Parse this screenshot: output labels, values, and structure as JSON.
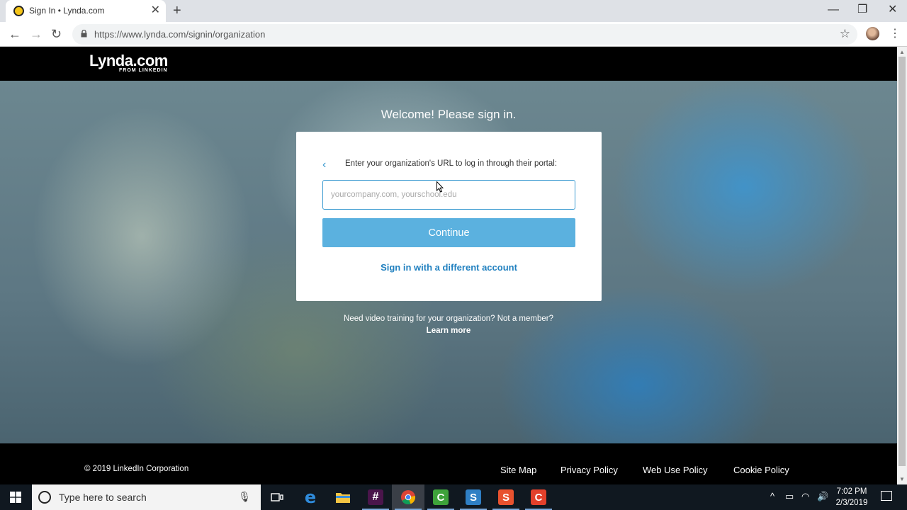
{
  "browser": {
    "tab_title": "Sign In • Lynda.com",
    "url": "https://www.lynda.com/signin/organization"
  },
  "site": {
    "logo_main": "Lynda.com",
    "logo_sub": "FROM LINKEDIN"
  },
  "signin": {
    "welcome": "Welcome! Please sign in.",
    "instruction": "Enter your organization's URL to log in through their portal:",
    "input_placeholder": "yourcompany.com, yourschool.edu",
    "continue_label": "Continue",
    "alt_link": "Sign in with a different account",
    "below_text": "Need video training for your organization? Not a member?",
    "learn_more": "Learn more"
  },
  "footer": {
    "copyright": "© 2019 LinkedIn Corporation",
    "links": [
      "Site Map",
      "Privacy Policy",
      "Web Use Policy",
      "Cookie Policy"
    ]
  },
  "taskbar": {
    "search_placeholder": "Type here to search",
    "time": "7:02 PM",
    "date": "2/3/2019",
    "pinned": [
      "task-view",
      "edge",
      "file-explorer",
      "slack",
      "chrome",
      "camtasia-green",
      "snagit",
      "snagit-orange",
      "camtasia-red"
    ]
  },
  "colors": {
    "accent": "#5bb1df",
    "link": "#2281c0",
    "header_bg": "#000000"
  }
}
